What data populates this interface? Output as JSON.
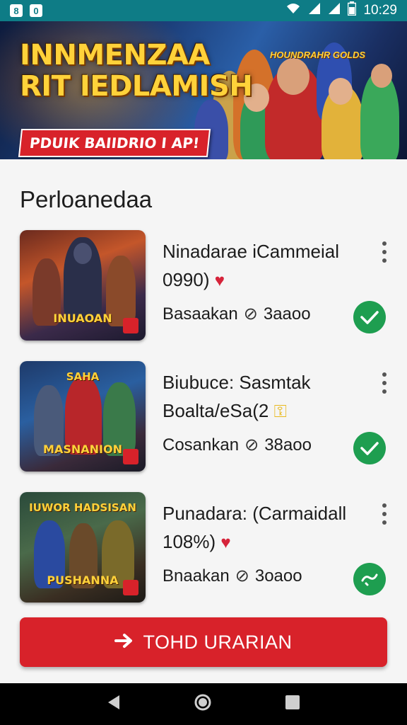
{
  "status_bar": {
    "left_icons": [
      "sim-icon",
      "notification-icon"
    ],
    "right_icons": [
      "wifi-icon",
      "signal-icon",
      "signal-icon",
      "battery-icon"
    ],
    "time": "10:29"
  },
  "banner": {
    "title_line1": "INNMENZAA",
    "title_line2": "RIT IEDLAMISH",
    "badge": "PDUIK BAIIDRIO I AP!",
    "small_text": "HOUNDRAHR GOLDS"
  },
  "section": {
    "title": "Perloanedaa"
  },
  "items": [
    {
      "title_line1": "Ninadarae iCammeial",
      "title_line2": "0990)",
      "title_icon": "heart-icon",
      "sub_label": "Basaakan",
      "sub_value": "3aaoo",
      "status_icon": "check-icon",
      "thumb_label": "INUAOAN",
      "thumb_top": ""
    },
    {
      "title_line1": "Biubuce: Sasmtak",
      "title_line2": "Boalta/eSa(2",
      "title_icon": "key-icon",
      "sub_label": "Cosankan",
      "sub_value": "38aoo",
      "status_icon": "check-icon",
      "thumb_label": "MASNANION",
      "thumb_top": "SAHA"
    },
    {
      "title_line1": "Punadara: (Carmaidall",
      "title_line2": "108%)",
      "title_icon": "heart-icon",
      "sub_label": "Bnaakan",
      "sub_value": "3oaoo",
      "status_icon": "link-icon",
      "thumb_label": "PUSHANNA",
      "thumb_top": "IUWOR HADSISAN"
    }
  ],
  "cta": {
    "label": "TOHD URARIAN",
    "icon": "arrow-right-icon"
  },
  "nav_bar": {
    "icons": [
      "back-icon",
      "home-icon",
      "recents-icon"
    ]
  },
  "colors": {
    "status_bar": "#0e7c86",
    "accent_red": "#d8222a",
    "check_green": "#1e9e50"
  }
}
